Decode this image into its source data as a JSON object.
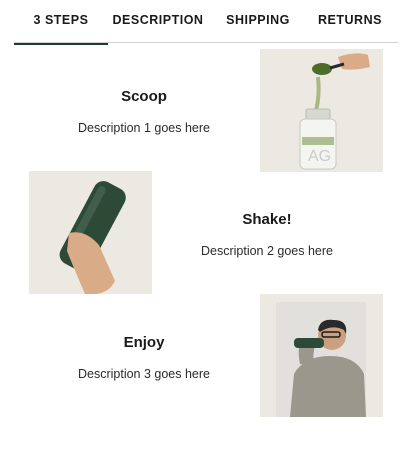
{
  "tabs": [
    {
      "label": "3 STEPS",
      "active": true
    },
    {
      "label": "DESCRIPTION",
      "active": false
    },
    {
      "label": "SHIPPING",
      "active": false
    },
    {
      "label": "RETURNS",
      "active": false
    }
  ],
  "steps": [
    {
      "title": "Scoop",
      "description": "Description 1 goes here",
      "image": "scoop-photo"
    },
    {
      "title": "Shake!",
      "description": "Description 2 goes here",
      "image": "shake-photo"
    },
    {
      "title": "Enjoy",
      "description": "Description 3 goes here",
      "image": "enjoy-photo"
    }
  ],
  "colors": {
    "accent": "#1d3b30",
    "photo_bg": "#ece9e3",
    "bottle": "#2d4a36"
  }
}
